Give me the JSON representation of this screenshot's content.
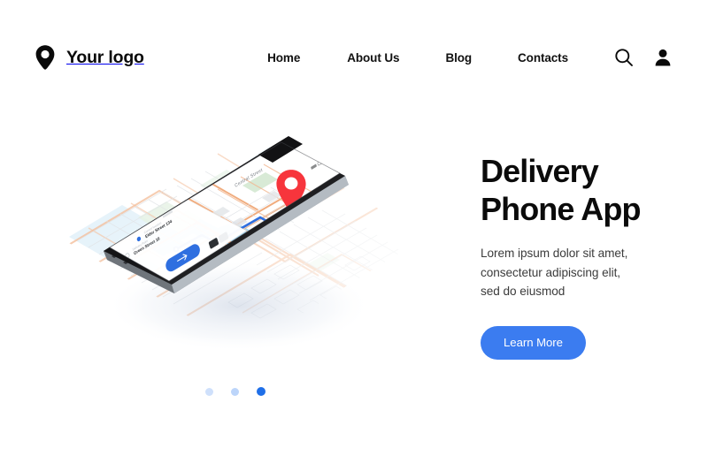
{
  "header": {
    "logo": {
      "icon": "map-pin-icon",
      "text": "Your logo"
    },
    "nav": [
      {
        "label": "Home"
      },
      {
        "label": "About Us"
      },
      {
        "label": "Blog"
      },
      {
        "label": "Contacts"
      }
    ],
    "actions": [
      {
        "icon": "search-icon",
        "label": "Search"
      },
      {
        "icon": "user-icon",
        "label": "Account"
      }
    ]
  },
  "hero": {
    "headline_line1": "Delivery",
    "headline_line2": "Phone App",
    "paragraph_line1": "Lorem ipsum dolor sit amet,",
    "paragraph_line2": "consectetur adipiscing elit,",
    "paragraph_line3": "sed do eiusmod",
    "cta_label": "Learn More"
  },
  "illustration": {
    "type": "isometric-phone-map",
    "map_street_label": "Central Street",
    "marker": "red-map-pin",
    "route": "blue-route-line",
    "phone_card": {
      "line1": "Elder Street 134",
      "line2": "Green Street 16",
      "action": "arrow-forward-button"
    },
    "colors": {
      "road": "#f0a878",
      "road_faded": "#f6c8a8",
      "water": "#a8d4ee",
      "park": "#d8ead6",
      "building": "#d9dcdf",
      "route": "#2f6fe0",
      "marker": "#f7353c",
      "phone_frame": "#1b1b1d",
      "phone_side": "#9aa0a6"
    }
  },
  "carousel": {
    "dots": [
      {
        "state": "inactive"
      },
      {
        "state": "inactive"
      },
      {
        "state": "active"
      }
    ]
  },
  "theme": {
    "accent_blue": "#3b7cf0",
    "dot_active": "#1f6fe8",
    "dot_inactive": "#cfe0fb",
    "text_dark": "#0b0b0b",
    "text_body": "#3b3b3b",
    "background": "#ffffff"
  }
}
